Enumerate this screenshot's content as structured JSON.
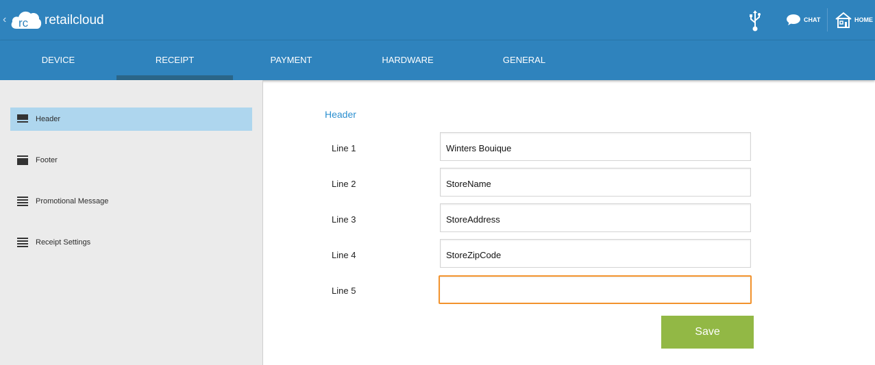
{
  "app": {
    "brand": "retailcloud",
    "logo_text": "rc",
    "back_glyph": "‹",
    "header_actions": [
      {
        "icon": "usb-icon",
        "label": ""
      },
      {
        "icon": "chat-icon",
        "label": "CHAT"
      },
      {
        "icon": "home-icon",
        "label": "HOME"
      }
    ],
    "colors": {
      "primary": "#2f83bd",
      "accent_text": "#2b8fd0",
      "save": "#92b845",
      "focus": "#f2922c",
      "selected_item": "#aed6ee"
    }
  },
  "tabs": [
    {
      "label": "DEVICE",
      "active": false
    },
    {
      "label": "RECEIPT",
      "active": true
    },
    {
      "label": "PAYMENT",
      "active": false
    },
    {
      "label": "HARDWARE",
      "active": false
    },
    {
      "label": "GENERAL",
      "active": false
    }
  ],
  "sidebar": {
    "items": [
      {
        "label": "Header",
        "icon": "header-list-icon",
        "selected": true
      },
      {
        "label": "Footer",
        "icon": "footer-list-icon",
        "selected": false
      },
      {
        "label": "Promotional Message",
        "icon": "list-icon",
        "selected": false
      },
      {
        "label": "Receipt Settings",
        "icon": "list-icon",
        "selected": false
      }
    ]
  },
  "form": {
    "title": "Header",
    "rows": [
      {
        "label": "Line 1",
        "value": "Winters Bouique"
      },
      {
        "label": "Line 2",
        "value": "StoreName"
      },
      {
        "label": "Line 3",
        "value": "StoreAddress"
      },
      {
        "label": "Line 4",
        "value": "StoreZipCode"
      },
      {
        "label": "Line 5",
        "value": ""
      }
    ],
    "save_label": "Save"
  }
}
